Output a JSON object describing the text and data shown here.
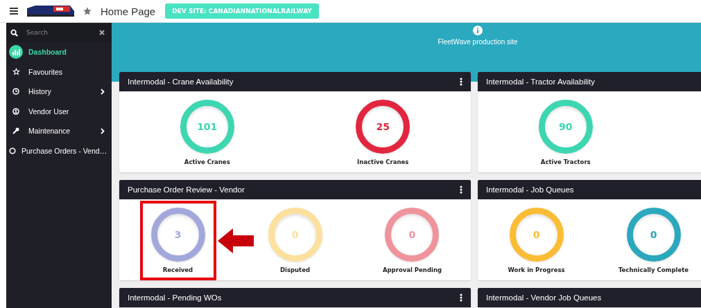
{
  "header": {
    "title": "Home Page",
    "badge": "DEV SITE: CANADIANNATIONALRAILWAY"
  },
  "sidebar": {
    "search": {
      "placeholder": "Search"
    },
    "items": [
      {
        "label": "Dashboard",
        "kind": "link",
        "selected": true
      },
      {
        "label": "Favourites",
        "kind": "link",
        "selected": false
      },
      {
        "label": "History",
        "kind": "group",
        "selected": false
      },
      {
        "label": "Vendor User",
        "kind": "link",
        "selected": false
      },
      {
        "label": "Maintenance",
        "kind": "group",
        "selected": false
      },
      {
        "label": "Purchase Orders - Vend…",
        "kind": "link",
        "selected": false
      }
    ]
  },
  "banner": {
    "text": "FleetWave production site"
  },
  "widgets": [
    {
      "title": "Intermodal - Crane Availability",
      "kind": "availability",
      "menu": true,
      "tiles": [
        {
          "value": "101",
          "label": "Active Cranes",
          "color": "#3dd6b0",
          "highlighted": false
        },
        {
          "value": "25",
          "label": "Inactive Cranes",
          "color": "#e3263f",
          "highlighted": false
        }
      ]
    },
    {
      "title": "Intermodal - Tractor Availability",
      "kind": "availability",
      "tiles": [
        {
          "value": "90",
          "label": "Active Tractors",
          "color": "#3dd6b0",
          "highlighted": false
        }
      ]
    },
    {
      "title": "Purchase Order Review - Vendor",
      "kind": "queue",
      "menu": true,
      "tiles": [
        {
          "value": "3",
          "label": "Received",
          "color": "#a3a8dc",
          "highlighted": true
        },
        {
          "value": "0",
          "label": "Disputed",
          "color": "#fde09e",
          "highlighted": false
        },
        {
          "value": "0",
          "label": "Approval Pending",
          "color": "#ef939c",
          "highlighted": false
        }
      ]
    },
    {
      "title": "Intermodal - Job Queues",
      "kind": "queue",
      "tiles": [
        {
          "value": "0",
          "label": "Work in Progress",
          "color": "#fbbd35",
          "highlighted": false
        },
        {
          "value": "0",
          "label": "Technically Complete",
          "color": "#2ba8bd",
          "highlighted": false
        }
      ]
    },
    {
      "title": "Intermodal - Pending WOs",
      "menu": true
    },
    {
      "title": "Intermodal - Vendor Job Queues"
    }
  ]
}
